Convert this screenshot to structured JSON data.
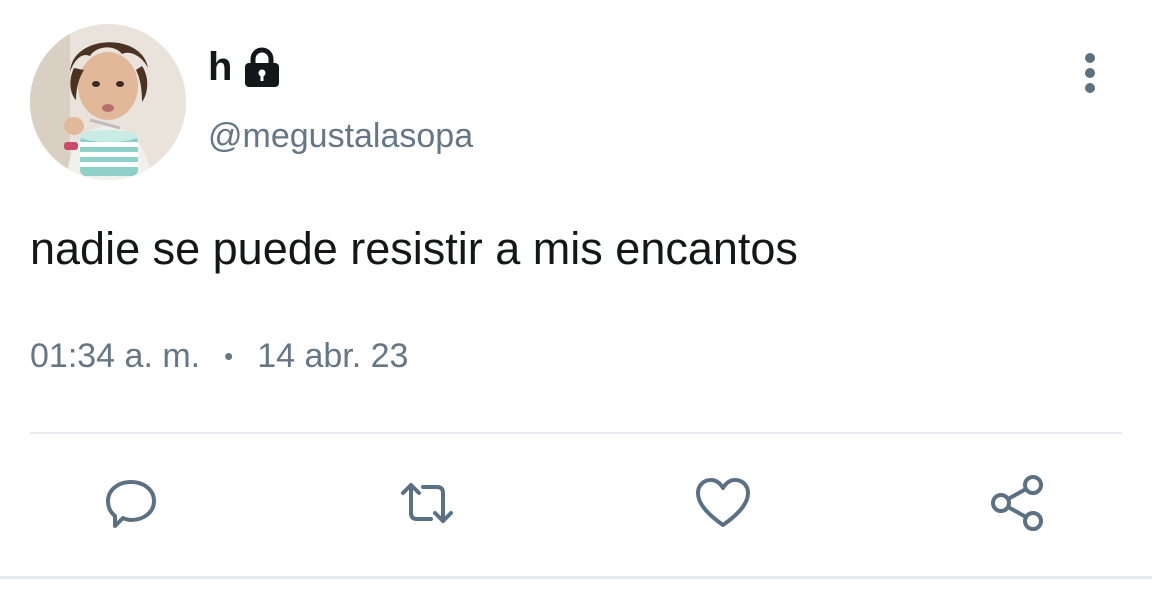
{
  "tweet": {
    "display_name": "h",
    "protected_icon": "lock-icon",
    "handle": "@megustalasopa",
    "text": "nadie se puede resistir a mis encantos",
    "time": "01:34 a. m.",
    "separator": "•",
    "date": "14 abr. 23",
    "more_icon": "more-vertical-icon",
    "avatar": "avatar-photo"
  },
  "actions": [
    {
      "icon": "reply-icon"
    },
    {
      "icon": "retweet-icon"
    },
    {
      "icon": "like-icon"
    },
    {
      "icon": "share-icon"
    }
  ],
  "colors": {
    "text_primary": "#14171a",
    "text_secondary": "#657786",
    "icon": "#5b7083",
    "divider": "#e6ecf0"
  }
}
